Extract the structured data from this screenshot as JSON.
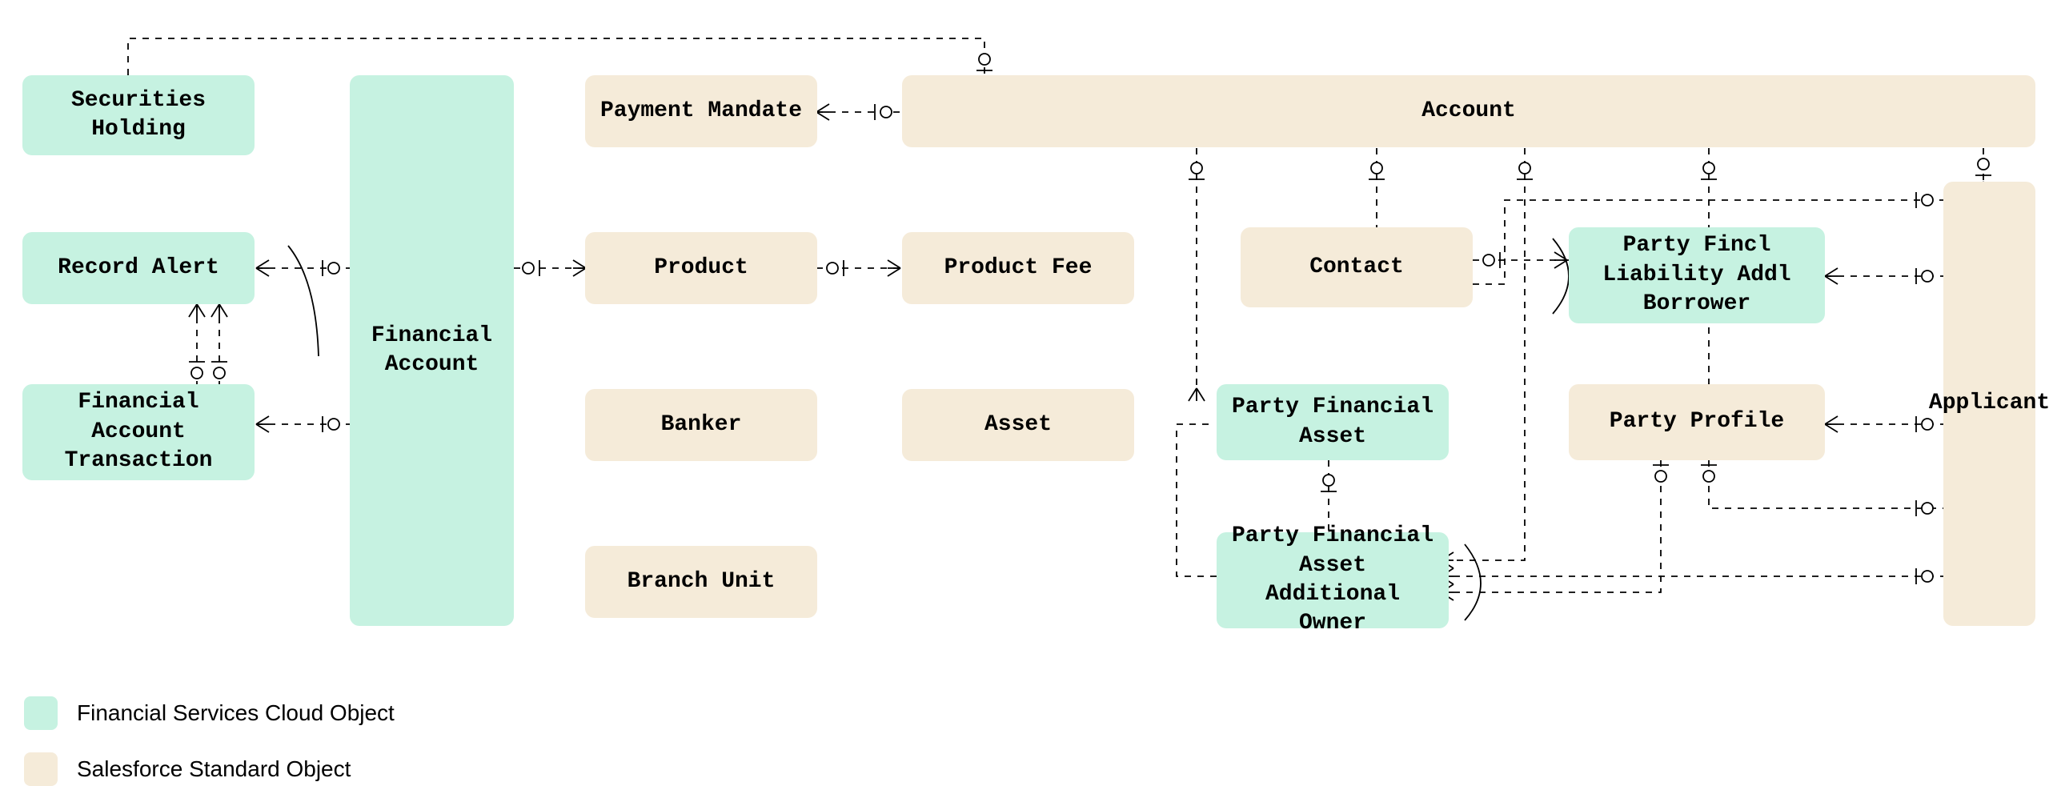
{
  "entities": {
    "securities_holding": "Securities Holding",
    "record_alert": "Record Alert",
    "fin_acct_txn": "Financial Account Transaction",
    "financial_account": "Financial Account",
    "payment_mandate": "Payment Mandate",
    "product": "Product",
    "banker": "Banker",
    "branch_unit": "Branch Unit",
    "product_fee": "Product Fee",
    "asset": "Asset",
    "account": "Account",
    "contact": "Contact",
    "party_fin_asset": "Party Financial Asset",
    "party_fin_asset_owner": "Party Financial Asset Additional Owner",
    "party_fincl_liab": "Party Fincl Liability Addl Borrower",
    "party_profile": "Party Profile",
    "applicant": "Applicant"
  },
  "legend": {
    "fsc": "Financial Services Cloud Object",
    "std": "Salesforce Standard Object"
  },
  "colors": {
    "fsc": "#C6F2E1",
    "std": "#F5EBD9"
  },
  "chart_data": {
    "type": "entity-relationship-diagram",
    "legend": [
      {
        "label": "Financial Services Cloud Object",
        "color": "#C6F2E1"
      },
      {
        "label": "Salesforce Standard Object",
        "color": "#F5EBD9"
      }
    ],
    "entities": [
      {
        "id": "securities_holding",
        "label": "Securities Holding",
        "category": "fsc"
      },
      {
        "id": "record_alert",
        "label": "Record Alert",
        "category": "fsc"
      },
      {
        "id": "fin_acct_txn",
        "label": "Financial Account Transaction",
        "category": "fsc"
      },
      {
        "id": "financial_account",
        "label": "Financial Account",
        "category": "fsc"
      },
      {
        "id": "payment_mandate",
        "label": "Payment Mandate",
        "category": "std"
      },
      {
        "id": "product",
        "label": "Product",
        "category": "std"
      },
      {
        "id": "banker",
        "label": "Banker",
        "category": "std"
      },
      {
        "id": "branch_unit",
        "label": "Branch Unit",
        "category": "std"
      },
      {
        "id": "product_fee",
        "label": "Product Fee",
        "category": "std"
      },
      {
        "id": "asset",
        "label": "Asset",
        "category": "std"
      },
      {
        "id": "account",
        "label": "Account",
        "category": "std"
      },
      {
        "id": "contact",
        "label": "Contact",
        "category": "std"
      },
      {
        "id": "party_fin_asset",
        "label": "Party Financial Asset",
        "category": "fsc"
      },
      {
        "id": "party_fin_asset_owner",
        "label": "Party Financial Asset Additional Owner",
        "category": "fsc"
      },
      {
        "id": "party_fincl_liab",
        "label": "Party Fincl Liability Addl Borrower",
        "category": "fsc"
      },
      {
        "id": "party_profile",
        "label": "Party Profile",
        "category": "std"
      },
      {
        "id": "applicant",
        "label": "Applicant",
        "category": "std"
      }
    ],
    "relationships": [
      {
        "from": "securities_holding",
        "to": "financial_account",
        "type": "many-to-one-optional"
      },
      {
        "from": "securities_holding",
        "to": "account",
        "type": "many-to-one-optional"
      },
      {
        "from": "record_alert",
        "to": "financial_account",
        "type": "many-to-one-optional"
      },
      {
        "from": "record_alert",
        "to": "fin_acct_txn",
        "type": "many-to-one-optional",
        "count": 2
      },
      {
        "from": "fin_acct_txn",
        "to": "financial_account",
        "type": "many-to-one-optional"
      },
      {
        "from": "payment_mandate",
        "to": "financial_account",
        "type": "many-to-one-optional"
      },
      {
        "from": "payment_mandate",
        "to": "account",
        "type": "many-to-one-optional"
      },
      {
        "from": "product",
        "to": "financial_account",
        "type": "one-to-many-optional"
      },
      {
        "from": "product",
        "to": "product_fee",
        "type": "one-to-many-optional"
      },
      {
        "from": "contact",
        "to": "account",
        "type": "many-to-one-optional"
      },
      {
        "from": "contact",
        "to": "party_fincl_liab",
        "type": "one-to-many-optional"
      },
      {
        "from": "party_fin_asset",
        "to": "account",
        "type": "many-to-one-optional"
      },
      {
        "from": "party_fin_asset",
        "to": "party_fin_asset_owner",
        "type": "one-to-many-optional"
      },
      {
        "from": "party_fin_asset_owner",
        "to": "account",
        "type": "many-to-one-optional"
      },
      {
        "from": "party_fin_asset_owner",
        "to": "contact",
        "type": "many-to-one-optional"
      },
      {
        "from": "party_fin_asset_owner",
        "to": "party_profile",
        "type": "many-to-one-optional"
      },
      {
        "from": "party_fin_asset_owner",
        "to": "applicant",
        "type": "many-to-one-optional"
      },
      {
        "from": "party_fincl_liab",
        "to": "account",
        "type": "many-to-one-optional"
      },
      {
        "from": "party_fincl_liab",
        "to": "party_profile",
        "type": "many-to-one-optional"
      },
      {
        "from": "party_fincl_liab",
        "to": "applicant",
        "type": "many-to-one-optional"
      },
      {
        "from": "party_profile",
        "to": "account",
        "type": "many-to-one-optional"
      },
      {
        "from": "party_profile",
        "to": "applicant",
        "type": "one-to-many-optional"
      },
      {
        "from": "applicant",
        "to": "account",
        "type": "many-to-one-optional"
      },
      {
        "from": "applicant",
        "to": "contact",
        "type": "many-to-one-optional"
      }
    ]
  }
}
